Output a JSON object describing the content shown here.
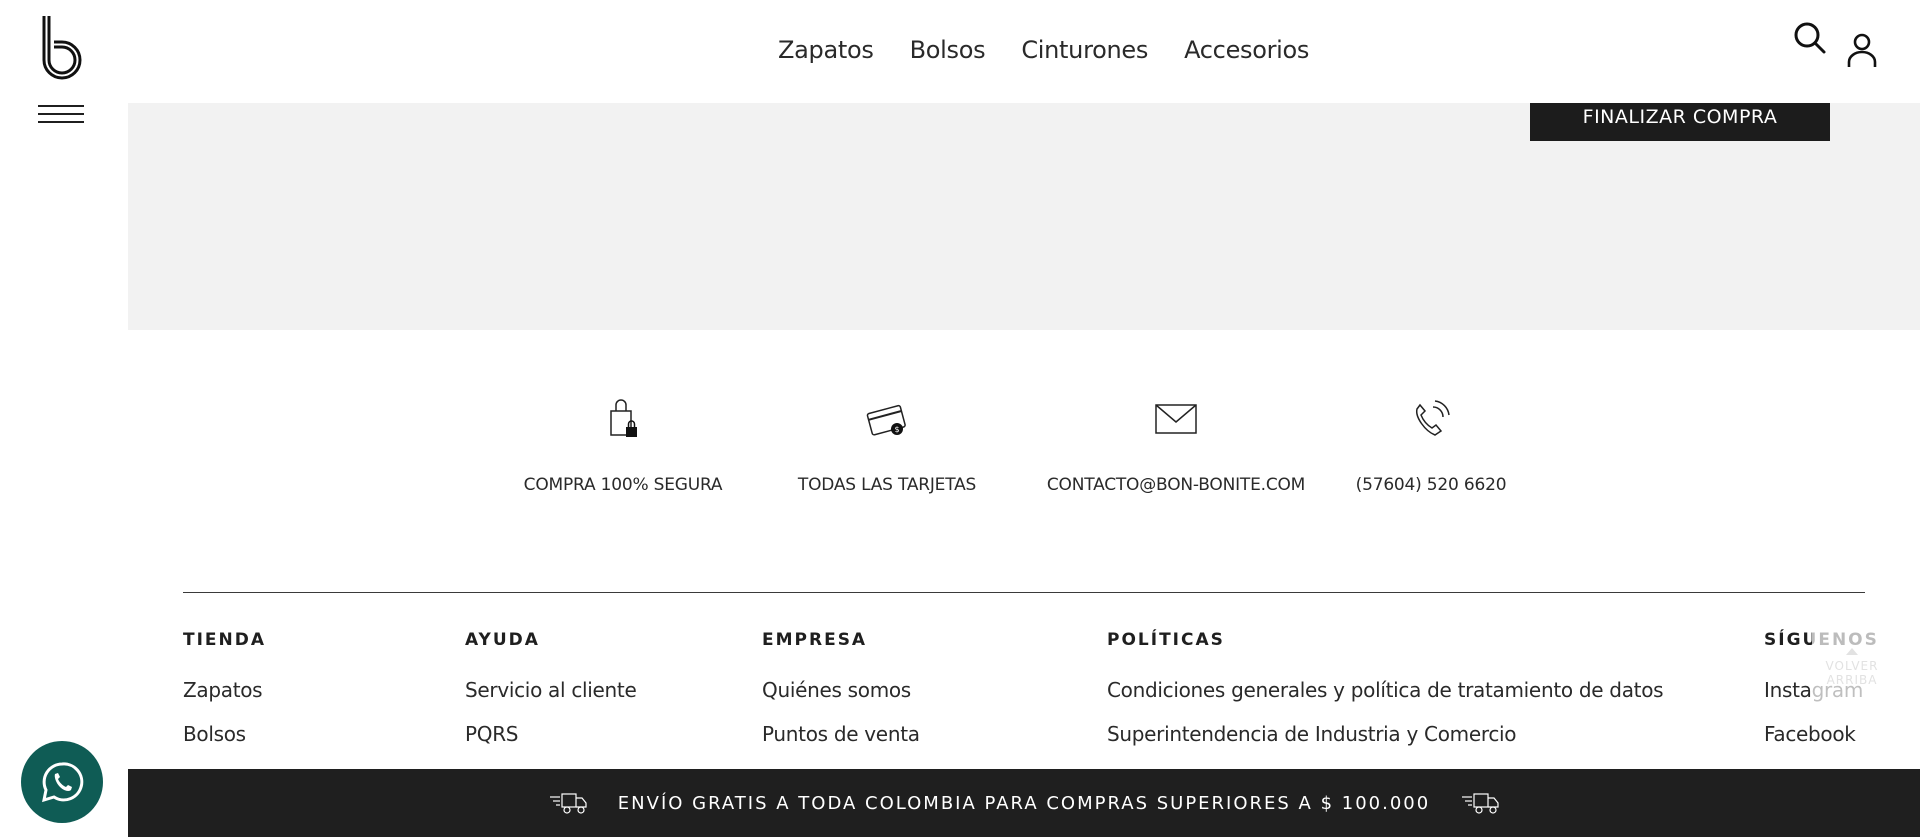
{
  "nav": {
    "items": [
      {
        "label": "Zapatos"
      },
      {
        "label": "Bolsos"
      },
      {
        "label": "Cinturones"
      },
      {
        "label": "Accesorios"
      }
    ]
  },
  "header_icons": [
    "search-icon",
    "user-icon"
  ],
  "cart": {
    "checkout_label": "FINALIZAR COMPRA"
  },
  "features": [
    {
      "icon": "secure-bag-icon",
      "label": "COMPRA 100% SEGURA"
    },
    {
      "icon": "credit-card-icon",
      "label": "TODAS LAS TARJETAS"
    },
    {
      "icon": "envelope-icon",
      "label": "CONTACTO@BON-BONITE.COM"
    },
    {
      "icon": "phone-icon",
      "label": "(57604) 520 6620"
    }
  ],
  "footer": {
    "columns": [
      {
        "title": "TIENDA",
        "links": [
          "Zapatos",
          "Bolsos"
        ]
      },
      {
        "title": "AYUDA",
        "links": [
          "Servicio al cliente",
          "PQRS"
        ]
      },
      {
        "title": "EMPRESA",
        "links": [
          "Quiénes somos",
          "Puntos de venta"
        ]
      },
      {
        "title": "POLÍTICAS",
        "links": [
          "Condiciones generales y política de tratamiento de datos",
          "Superintendencia de Industria y Comercio"
        ]
      },
      {
        "title": "SÍGUENOS",
        "links": [
          "Instagram",
          "Facebook"
        ]
      }
    ]
  },
  "back_to_top": {
    "line1": "VOLVER",
    "line2": "ARRIBA"
  },
  "shipping_bar": {
    "text": "ENVÍO GRATIS A TODA COLOMBIA PARA COMPRAS SUPERIORES A $ 100.000"
  },
  "colors": {
    "dark": "#1f1f1f",
    "gray_panel": "#f2f2f2",
    "whatsapp": "#0f5c55"
  }
}
